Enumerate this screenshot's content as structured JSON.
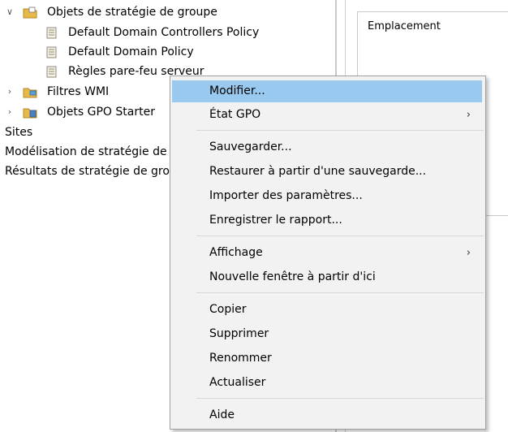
{
  "tree": {
    "root_label": "Objets de stratégie de groupe",
    "children": [
      "Default Domain Controllers Policy",
      "Default Domain Policy",
      "Règles pare-feu serveur"
    ],
    "wmi_filters": "Filtres WMI",
    "gpo_starters": "Objets GPO Starter",
    "sites": "Sites",
    "modeling": "Modélisation de stratégie de",
    "results": "Résultats de stratégie de gro"
  },
  "right_pane": {
    "column_header": "Emplacement"
  },
  "context_menu": {
    "edit": "Modifier...",
    "gpo_status": "État GPO",
    "backup": "Sauvegarder...",
    "restore": "Restaurer à partir d'une sauvegarde...",
    "import": "Importer des paramètres...",
    "save_report": "Enregistrer le rapport...",
    "view": "Affichage",
    "new_window": "Nouvelle fenêtre à partir d'ici",
    "copy": "Copier",
    "delete": "Supprimer",
    "rename": "Renommer",
    "refresh": "Actualiser",
    "help": "Aide",
    "submenu_arrow": "›"
  },
  "colors": {
    "highlight": "#99c9ef",
    "menu_bg": "#f2f2f2",
    "folder": "#e8b84a"
  }
}
